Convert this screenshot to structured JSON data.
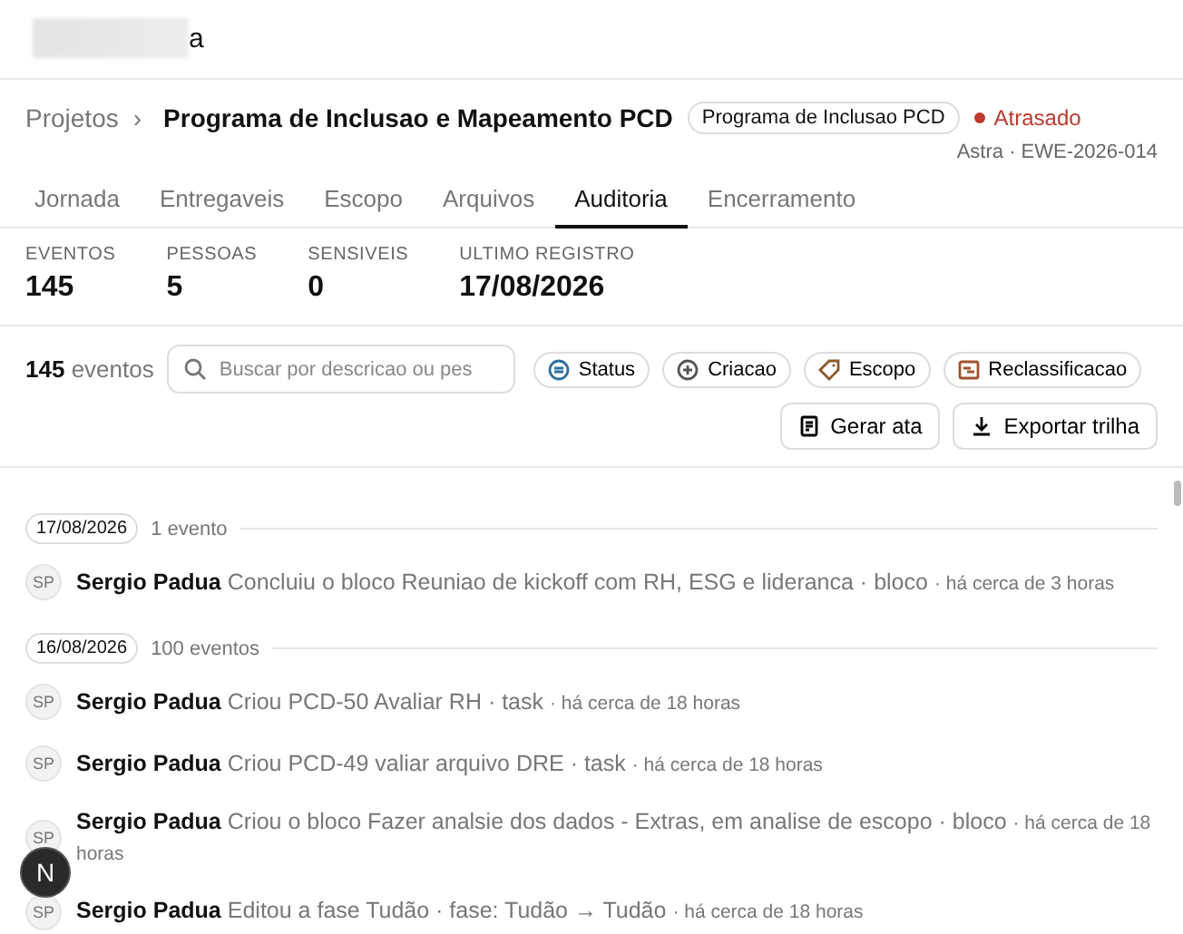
{
  "header": {
    "title": "a"
  },
  "breadcrumb": {
    "parent": "Projetos",
    "separator": "›",
    "current": "Programa de Inclusao e Mapeamento PCD",
    "badge": "Programa de Inclusao PCD",
    "status": "Atrasado"
  },
  "subtitle": "Astra · EWE-2026-014",
  "tabs": [
    {
      "label": "Jornada",
      "selected": false
    },
    {
      "label": "Entregaveis",
      "selected": false
    },
    {
      "label": "Escopo",
      "selected": false
    },
    {
      "label": "Arquivos",
      "selected": false
    },
    {
      "label": "Auditoria",
      "selected": true
    },
    {
      "label": "Encerramento",
      "selected": false
    }
  ],
  "stats": [
    {
      "label": "EVENTOS",
      "value": "145"
    },
    {
      "label": "PESSOAS",
      "value": "5"
    },
    {
      "label": "SENSIVEIS",
      "value": "0"
    },
    {
      "label": "ULTIMO REGISTRO",
      "value": "17/08/2026"
    }
  ],
  "toolbar": {
    "count": "145",
    "count_label": "eventos",
    "search": {
      "placeholder": "Buscar por descricao ou pes"
    },
    "filters": [
      {
        "label": "Status",
        "kind": "status",
        "color": "#2f6f9f"
      },
      {
        "label": "Criacao",
        "kind": "create",
        "color": "#555555"
      },
      {
        "label": "Escopo",
        "kind": "tag",
        "color": "#8a5a2b"
      },
      {
        "label": "Reclassificacao",
        "kind": "reclass",
        "color": "#a0522d"
      }
    ],
    "actions": [
      {
        "label": "Gerar ata",
        "kind": "doc"
      },
      {
        "label": "Exportar trilha",
        "kind": "download"
      }
    ]
  },
  "groups": [
    {
      "date": "17/08/2026",
      "count": "1 evento",
      "events": [
        {
          "initials": "SP",
          "actor": "Sergio Padua",
          "action": "Concluiu o bloco Reuniao de kickoff com RH, ESG e lideranca · bloco",
          "time": "· há cerca de 3 horas"
        }
      ]
    },
    {
      "date": "16/08/2026",
      "count": "100 eventos",
      "events": [
        {
          "initials": "SP",
          "actor": "Sergio Padua",
          "action": "Criou PCD-50 Avaliar RH · task",
          "time": "· há cerca de 18 horas"
        },
        {
          "initials": "SP",
          "actor": "Sergio Padua",
          "action": "Criou PCD-49 valiar arquivo DRE · task",
          "time": "· há cerca de 18 horas"
        },
        {
          "initials": "SP",
          "actor": "Sergio Padua",
          "action": "Criou o bloco Fazer analsie dos dados - Extras, em analise de escopo · bloco",
          "time": "· há cerca de 18 horas"
        },
        {
          "initials": "SP",
          "actor": "Sergio Padua",
          "action": "Editou a fase Tudão · fase: Tudão → Tudão",
          "time": "· há cerca de 18 horas"
        }
      ]
    }
  ],
  "floating_button": {
    "label": "N"
  }
}
